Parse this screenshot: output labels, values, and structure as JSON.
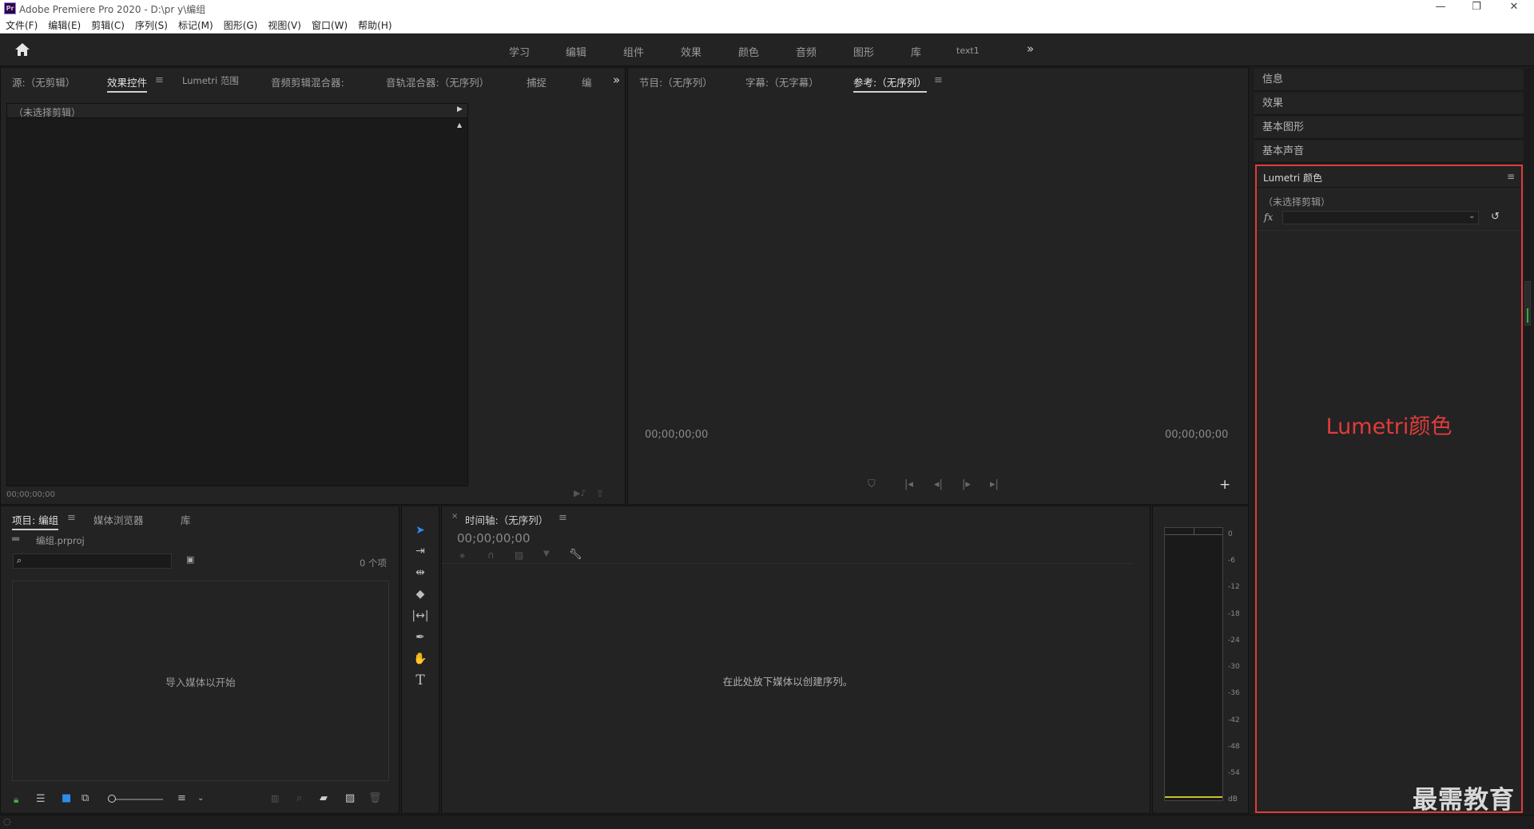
{
  "app": {
    "title": "Adobe Premiere Pro 2020 - D:\\pr y\\编组",
    "logo_text": "Pr",
    "window_controls": [
      "—",
      "❐",
      "✕"
    ]
  },
  "menu": [
    "文件(F)",
    "编辑(E)",
    "剪辑(C)",
    "序列(S)",
    "标记(M)",
    "图形(G)",
    "视图(V)",
    "窗口(W)",
    "帮助(H)"
  ],
  "workspaces": [
    "学习",
    "编辑",
    "组件",
    "效果",
    "颜色",
    "音频",
    "图形",
    "库",
    "text1"
  ],
  "source_panel": {
    "tabs": [
      "源:（无剪辑）",
      "效果控件",
      "Lumetri 范围",
      "音频剪辑混合器:",
      "音轨混合器:（无序列）",
      "捕捉",
      "编"
    ],
    "active_tab": "效果控件",
    "no_clip": "（未选择剪辑）",
    "timecode": "00;00;00;00"
  },
  "program_panel": {
    "tabs": [
      "节目:（无序列）",
      "字幕:（无字幕）",
      "参考:（无序列）"
    ],
    "active_tab": "参考:（无序列）",
    "timecode_left": "00;00;00;00",
    "timecode_right": "00;00;00;00"
  },
  "project_panel": {
    "tabs": [
      "项目: 编组",
      "媒体浏览器",
      "库"
    ],
    "active_tab": "项目: 编组",
    "filename": "编组.prproj",
    "item_count": "0 个项",
    "empty_text": "导入媒体以开始"
  },
  "timeline_panel": {
    "title": "时间轴:（无序列）",
    "timecode": "00;00;00;00",
    "empty_text": "在此处放下媒体以创建序列。"
  },
  "audio_meter": {
    "ticks": [
      "0",
      "-6",
      "-12",
      "-18",
      "-24",
      "-30",
      "-36",
      "-42",
      "-48",
      "-54",
      "dB"
    ]
  },
  "right_panels": {
    "items": [
      "信息",
      "效果",
      "基本图形",
      "基本声音"
    ],
    "lumetri": {
      "title": "Lumetri 颜色",
      "no_clip": "（未选择剪辑）",
      "fx": "fx",
      "annotation": "Lumetri颜色"
    }
  },
  "watermark": "最需教育"
}
